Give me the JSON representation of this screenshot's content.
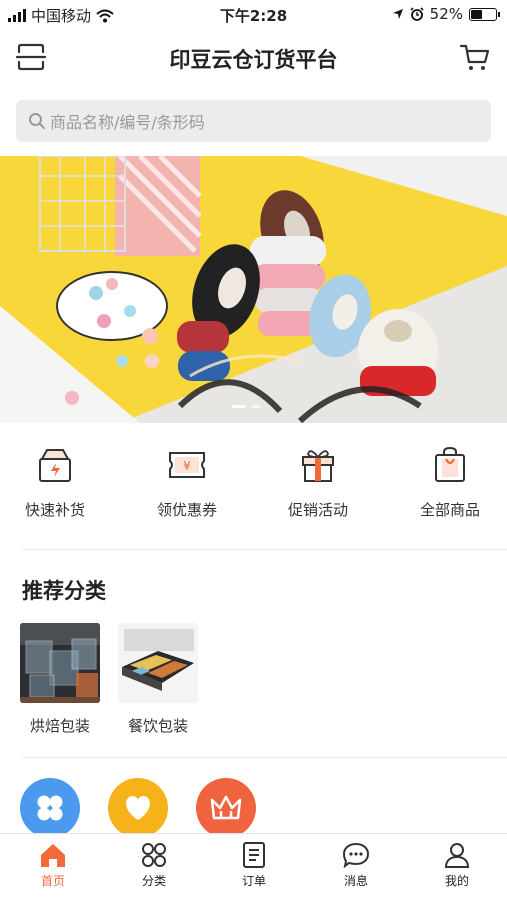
{
  "status_bar": {
    "carrier": "中国移动",
    "time": "下午2:28",
    "battery": "52%",
    "battery_level": 0.52
  },
  "header": {
    "title": "印豆云仓订货平台",
    "scan_icon": "scan-icon",
    "cart_icon": "cart-icon"
  },
  "search": {
    "placeholder": "商品名称/编号/条形码"
  },
  "banner": {
    "page_count": 2,
    "active_index": 1
  },
  "quick_actions": [
    {
      "label": "快速补货",
      "icon": "restock-icon"
    },
    {
      "label": "领优惠券",
      "icon": "coupon-icon"
    },
    {
      "label": "促销活动",
      "icon": "gift-icon"
    },
    {
      "label": "全部商品",
      "icon": "bag-icon"
    }
  ],
  "recommended": {
    "title": "推荐分类",
    "items": [
      {
        "label": "烘焙包装"
      },
      {
        "label": "餐饮包装"
      }
    ]
  },
  "circle_entries": [
    {
      "icon": "clover-icon",
      "color": "#4a9af0"
    },
    {
      "icon": "heart-icon",
      "color": "#f6b21a"
    },
    {
      "icon": "crown-icon",
      "color": "#f0633f"
    }
  ],
  "tab_bar": {
    "active_color": "#f06a3a",
    "tabs": [
      {
        "label": "首页",
        "icon": "home-icon",
        "active": true
      },
      {
        "label": "分类",
        "icon": "grid-icon",
        "active": false
      },
      {
        "label": "订单",
        "icon": "order-icon",
        "active": false
      },
      {
        "label": "消息",
        "icon": "message-icon",
        "active": false
      },
      {
        "label": "我的",
        "icon": "user-icon",
        "active": false
      }
    ]
  }
}
